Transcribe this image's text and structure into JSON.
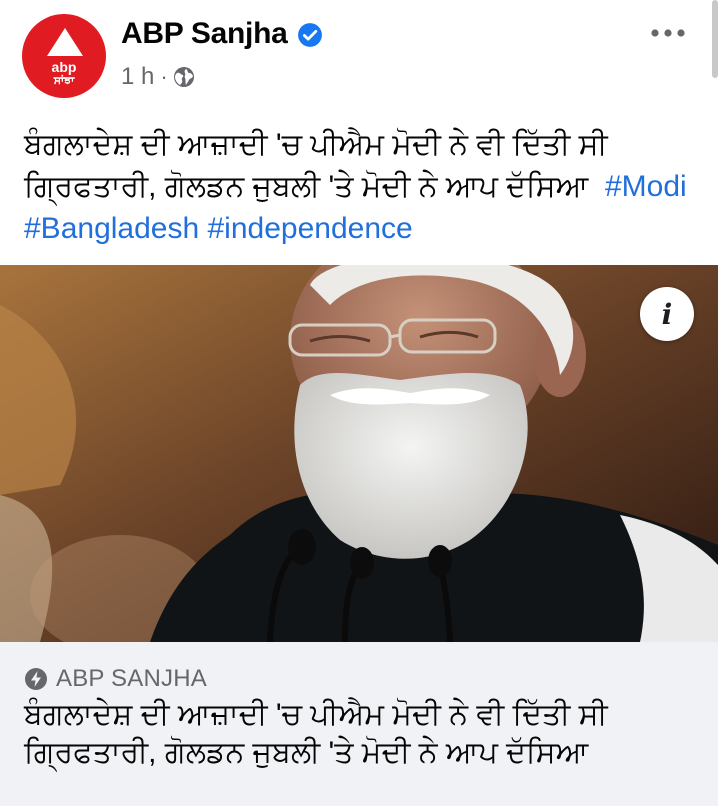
{
  "post": {
    "page_name": "ABP Sanjha",
    "avatar": {
      "line1": "abp",
      "line2": "ਸਾਂਝਾ"
    },
    "time": "1 h",
    "separator": "·",
    "message": {
      "text": "ਬੰਗਲਾਦੇਸ਼ ਦੀ ਆਜ਼ਾਦੀ 'ਚ ਪੀਐਮ ਮੋਦੀ ਨੇ ਵੀ ਦਿੱਤੀ ਸੀ ਗ੍ਰਿਫਤਾਰੀ, ਗੋਲਡਨ ਜੁਬਲੀ 'ਤੇ ਮੋਦੀ ਨੇ ਆਪ ਦੱਸਿਆ",
      "hashtags": [
        "#Modi",
        "#Bangladesh",
        "#independence"
      ]
    },
    "photo_info_glyph": "i",
    "link": {
      "source": "ABP SANJHA",
      "title": "ਬੰਗਲਾਦੇਸ਼ ਦੀ ਆਜ਼ਾਦੀ 'ਚ ਪੀਐਮ ਮੋਦੀ ਨੇ ਵੀ ਦਿੱਤੀ ਸੀ ਗ੍ਰਿਫਤਾਰੀ, ਗੋਲਡਨ ਜੁਬਲੀ 'ਤੇ ਮੋਦੀ ਨੇ ਆਪ ਦੱਸਿਆ"
    }
  },
  "icons": {
    "verified": "verified-badge-icon",
    "audience": "globe-icon",
    "more": "more-options-icon",
    "info": "info-icon",
    "source": "lightning-bolt-icon"
  },
  "colors": {
    "brand_red": "#e11b22",
    "hashtag_blue": "#216fdb",
    "verified_blue": "#1877f2",
    "secondary_text": "#65676b",
    "link_background": "#f0f2f5"
  }
}
